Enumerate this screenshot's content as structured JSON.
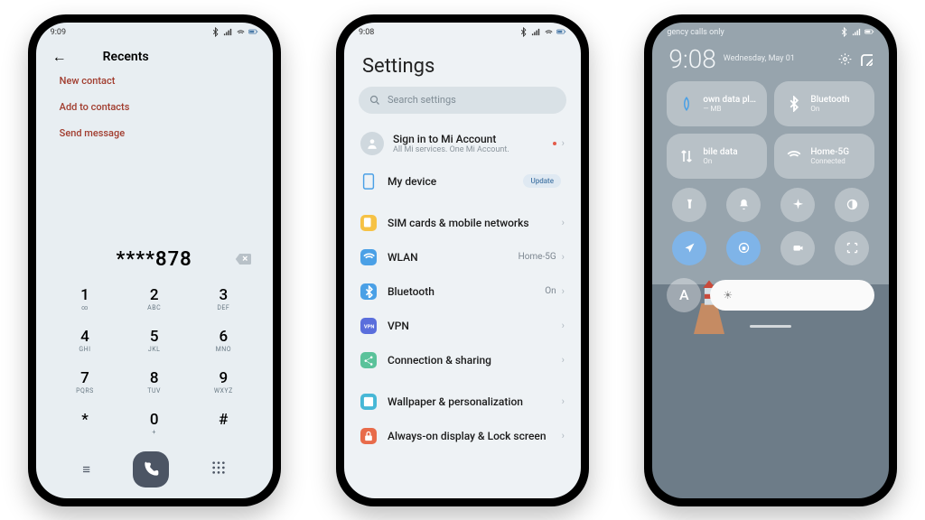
{
  "colors": {
    "brand_red": "#a13c2e",
    "blue": "#4a7aa8"
  },
  "p1": {
    "status_time": "9:09",
    "title": "Recents",
    "actions": [
      "New contact",
      "Add to contacts",
      "Send message"
    ],
    "number": "****878",
    "keys": [
      {
        "d": "1",
        "l": "∞"
      },
      {
        "d": "2",
        "l": "ABC"
      },
      {
        "d": "3",
        "l": "DEF"
      },
      {
        "d": "4",
        "l": "GHI"
      },
      {
        "d": "5",
        "l": "JKL"
      },
      {
        "d": "6",
        "l": "MNO"
      },
      {
        "d": "7",
        "l": "PQRS"
      },
      {
        "d": "8",
        "l": "TUV"
      },
      {
        "d": "9",
        "l": "WXYZ"
      },
      {
        "d": "*",
        "l": ""
      },
      {
        "d": "0",
        "l": "+"
      },
      {
        "d": "#",
        "l": ""
      }
    ]
  },
  "p2": {
    "status_time": "9:08",
    "title": "Settings",
    "search_ph": "Search settings",
    "account": {
      "title": "Sign in to Mi Account",
      "sub": "All Mi services. One Mi Account."
    },
    "device": {
      "title": "My device",
      "badge": "Update"
    },
    "rows": [
      {
        "icon": "sim",
        "color": "#f6c245",
        "title": "SIM cards & mobile networks",
        "val": ""
      },
      {
        "icon": "wifi",
        "color": "#4aa0e6",
        "title": "WLAN",
        "val": "Home-5G"
      },
      {
        "icon": "bt",
        "color": "#4aa0e6",
        "title": "Bluetooth",
        "val": "On"
      },
      {
        "icon": "vpn",
        "color": "#5a6edc",
        "title": "VPN",
        "val": ""
      },
      {
        "icon": "share",
        "color": "#5ac29a",
        "title": "Connection & sharing",
        "val": ""
      }
    ],
    "rows2": [
      {
        "icon": "wall",
        "color": "#46b7d6",
        "title": "Wallpaper & personalization"
      },
      {
        "icon": "lock",
        "color": "#e86b4a",
        "title": "Always-on display & Lock screen"
      }
    ]
  },
  "p3": {
    "status_text": "gency calls only",
    "clock": "9:08",
    "date": "Wednesday, May 01",
    "tiles": [
      {
        "iconcolor": "#4aa0e6",
        "a": "own data pl…",
        "b": "— MB",
        "name": "data-plan"
      },
      {
        "iconcolor": "#ffffff",
        "a": "Bluetooth",
        "b": "On",
        "name": "bluetooth"
      },
      {
        "iconcolor": "#ffffff",
        "a": "bile data",
        "b": "On",
        "name": "mobile-data"
      },
      {
        "iconcolor": "#ffffff",
        "a": "Home-5G",
        "b": "Connected",
        "name": "wifi"
      }
    ],
    "circles": [
      {
        "name": "flashlight",
        "on": false
      },
      {
        "name": "bell",
        "on": false
      },
      {
        "name": "airplane",
        "on": false
      },
      {
        "name": "contrast",
        "on": false
      },
      {
        "name": "location",
        "on": true
      },
      {
        "name": "rotate-lock",
        "on": true
      },
      {
        "name": "camera",
        "on": false
      },
      {
        "name": "scanner",
        "on": false
      }
    ],
    "auto": "A"
  }
}
